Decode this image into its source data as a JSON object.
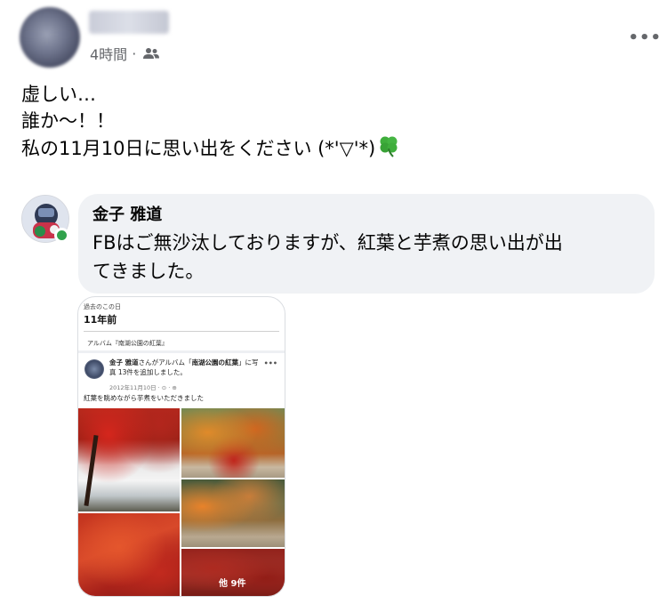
{
  "post": {
    "time": "4時間",
    "separator": "·",
    "audience_icon": "friends-icon",
    "more_icon": "more-options-icon",
    "lines": [
      "虚しい…",
      "誰か〜！！",
      "私の11月10日に思い出をください (*'▽'*)"
    ],
    "emoji": "four-leaf-clover"
  },
  "comment": {
    "author": "金子 雅道",
    "text_line1": "FBはご無沙汰しておりますが、紅葉と芋煮の思い出が出",
    "text_line2": "てきました。",
    "online_color": "#31a24c"
  },
  "attachment": {
    "section_label": "過去のこの日",
    "years_ago": "11年前",
    "album_label": "アルバム『南湖公園の紅葉』",
    "post_author": "金子 雅道",
    "post_action_pre": "さんがアルバム「",
    "post_album_name": "南湖公園の紅葉",
    "post_action_post": "」に写真 13件を追加しました。",
    "post_date": "2012年11月10日 · ⊙ · ⊕",
    "caption": "紅葉を眺めながら芋煮をいただきました",
    "more_photos": "他 9件"
  },
  "colors": {
    "bubble_bg": "#f0f2f5",
    "meta_text": "#65676b",
    "text": "#050505"
  }
}
